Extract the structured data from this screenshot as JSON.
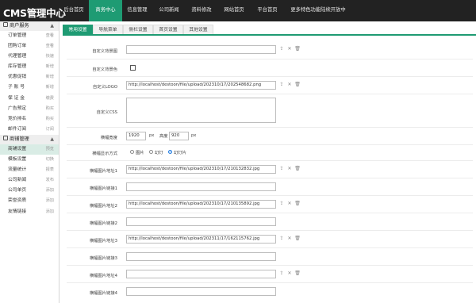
{
  "app": {
    "title": "CMS管理中心"
  },
  "topnav": [
    {
      "label": "后台首页",
      "active": false
    },
    {
      "label": "商务中心",
      "active": true
    },
    {
      "label": "信息管理",
      "active": false
    },
    {
      "label": "公司新闻",
      "active": false
    },
    {
      "label": "资料修改",
      "active": false
    },
    {
      "label": "网站首页",
      "active": false
    },
    {
      "label": "平台首页",
      "active": false
    },
    {
      "label": "更多特色功能陆续开放中",
      "active": false
    }
  ],
  "sidebar": {
    "groups": [
      {
        "label": "商户服务",
        "chevron": "▲",
        "items": [
          {
            "label": "订单管理",
            "right": "查看"
          },
          {
            "label": "团购订单",
            "right": "查看"
          },
          {
            "label": "代理管理",
            "right": "快速"
          },
          {
            "label": "库存管理",
            "right": "新增"
          },
          {
            "label": "优惠促销",
            "right": "新增"
          },
          {
            "label": "子 账 号",
            "right": "新增"
          },
          {
            "label": "保 证 金",
            "right": "缴费"
          },
          {
            "label": "广告预定",
            "right": "购买"
          },
          {
            "label": "竞价排名",
            "right": "购买"
          },
          {
            "label": "邮件订阅",
            "right": "订阅"
          }
        ]
      },
      {
        "label": "商铺管理",
        "chevron": "▲",
        "items": [
          {
            "label": "商铺设置",
            "right": "预览",
            "active": true
          },
          {
            "label": "模板设置",
            "right": "切换"
          },
          {
            "label": "流量统计",
            "right": "报表"
          },
          {
            "label": "公司新闻",
            "right": "发布"
          },
          {
            "label": "公司单页",
            "right": "添加"
          },
          {
            "label": "荣誉资质",
            "right": "添加"
          },
          {
            "label": "友情链接",
            "right": "添加"
          }
        ]
      }
    ]
  },
  "tabs": [
    {
      "label": "常用设置",
      "active": true
    },
    {
      "label": "导航菜单",
      "active": false
    },
    {
      "label": "侧栏设置",
      "active": false
    },
    {
      "label": "首页设置",
      "active": false
    },
    {
      "label": "其他设置",
      "active": false
    }
  ],
  "icons": {
    "upload": "⇪",
    "close": "✕",
    "delete": "🗑"
  },
  "form": {
    "bg_image": {
      "label": "自定义背景图",
      "value": ""
    },
    "bg_color": {
      "label": "自定义背景色"
    },
    "logo": {
      "label": "自定义LOGO",
      "value": "http://localhost/destoon/file/upload/202310/17/202548682.png"
    },
    "css": {
      "label": "自定义CSS"
    },
    "banner_size": {
      "label": "横幅宽度",
      "width": "1920",
      "px1": "px",
      "height_label": "高度",
      "height": "920",
      "px2": "px"
    },
    "banner_mode": {
      "label": "横幅显示方式",
      "options": [
        "图片",
        "幻灯",
        "幻灯片"
      ],
      "selected": 2
    },
    "banner1": {
      "label": "横幅图片地址1",
      "value": "http://localhost/destoon/file/upload/202310/17/210132832.jpg"
    },
    "link1": {
      "label": "横幅图片链接1",
      "value": ""
    },
    "banner2": {
      "label": "横幅图片地址2",
      "value": "http://localhost/destoon/file/upload/202310/17/210135892.jpg"
    },
    "link2": {
      "label": "横幅图片链接2",
      "value": ""
    },
    "banner3": {
      "label": "横幅图片地址3",
      "value": "http://localhost/destoon/file/upload/202311/17/162115762.jpg"
    },
    "link3": {
      "label": "横幅图片链接3",
      "value": ""
    },
    "banner4": {
      "label": "横幅图片地址4",
      "value": ""
    },
    "link4": {
      "label": "横幅图片链接4",
      "value": ""
    }
  }
}
